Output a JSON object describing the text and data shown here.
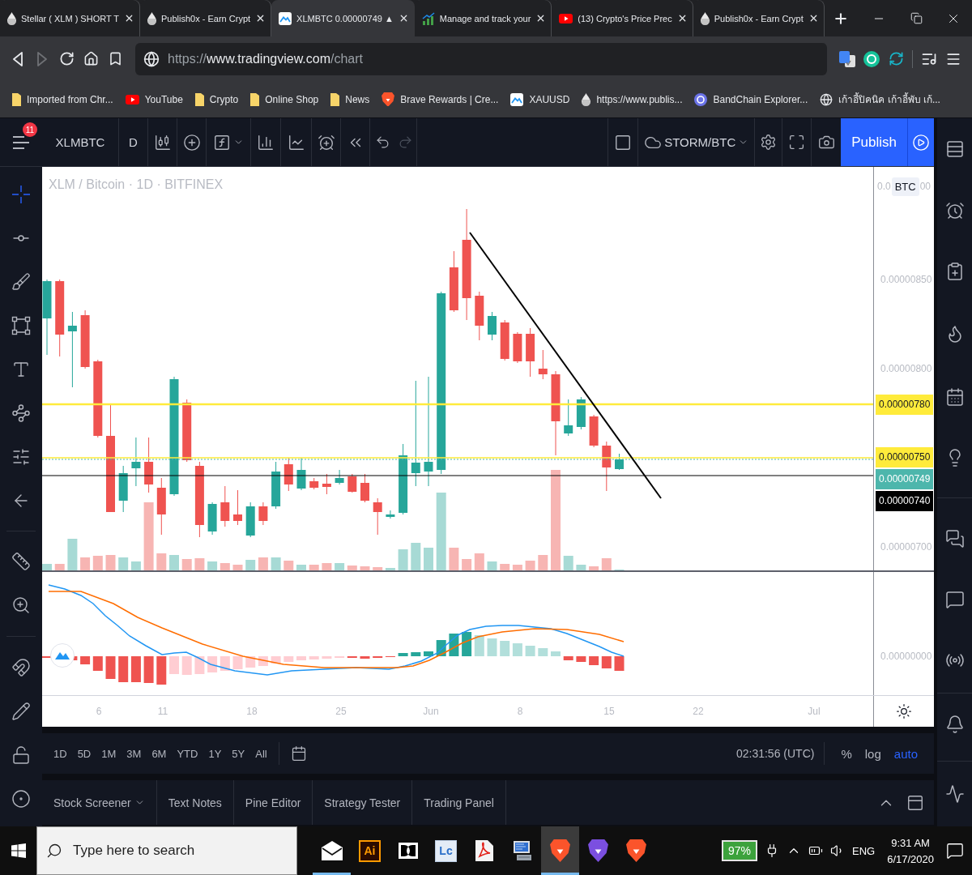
{
  "browser": {
    "tabs": [
      {
        "title": "Stellar ( XLM ) SHORT T",
        "kind": "drop",
        "selected": false
      },
      {
        "title": "Publish0x - Earn Crypt",
        "kind": "drop",
        "selected": false
      },
      {
        "title": "XLMBTC 0.00000749 ▲",
        "kind": "chart",
        "selected": true
      },
      {
        "title": "Manage and track your",
        "kind": "growth",
        "selected": false
      },
      {
        "title": "(13) Crypto's Price Prec",
        "kind": "video",
        "selected": false
      },
      {
        "title": "Publish0x - Earn Crypt",
        "kind": "drop",
        "selected": false
      }
    ],
    "navigation": [
      {
        "disabled": false
      },
      {
        "disabled": true
      }
    ],
    "address": {
      "scheme": "https://",
      "host": "www.tradingview.com",
      "path": "/chart"
    },
    "bookmarks": [
      {
        "label": "Imported from Chr...",
        "kind": "folder"
      },
      {
        "label": "YouTube",
        "kind": "video"
      },
      {
        "label": "Crypto",
        "kind": "folder"
      },
      {
        "label": "Online Shop",
        "kind": "folder"
      },
      {
        "label": "News",
        "kind": "folder"
      },
      {
        "label": "Brave Rewards | Cre...",
        "kind": "shield"
      },
      {
        "label": "XAUUSD",
        "kind": "chart"
      },
      {
        "label": "https://www.publis...",
        "kind": "drop"
      },
      {
        "label": "BandChain Explorer...",
        "kind": "coin"
      },
      {
        "label": "เก้าอี้ปิคนิค เก้าอี้พับ เก้...",
        "kind": "globe"
      }
    ]
  },
  "app": {
    "menu_badge": "11",
    "toolbar": {
      "symbol": "XLMBTC",
      "interval": "D",
      "history": [
        {
          "disabled": false
        },
        {
          "disabled": true
        }
      ],
      "compare": "STORM/BTC",
      "publish": "Publish"
    },
    "drawing_tools": [
      {
        "selected": true
      },
      {
        "selected": false
      },
      {
        "selected": false
      },
      {
        "selected": false
      },
      {
        "selected": false
      },
      {
        "selected": false
      },
      {
        "selected": false
      },
      {
        "selected": false
      },
      {
        "selected": false
      },
      {
        "selected": false
      },
      {
        "selected": false
      },
      {
        "selected": false
      },
      {
        "selected": false
      },
      {
        "selected": false
      }
    ],
    "chart": {
      "legend": "XLM / Bitcoin · 1D · BITFINEX",
      "currency": "BTC",
      "top_tick": {
        "start": "0.0",
        "end": "00"
      },
      "price_ticks": [
        "0.00000850",
        "0.00000800",
        "0.00000700"
      ],
      "price_lines": [
        {
          "label": "0.00000780",
          "color": "#ffeb3b"
        },
        {
          "label": "0.00000750",
          "color": "#ffeb3b"
        },
        {
          "label": "0.00000749",
          "color": "#4db6ac"
        },
        {
          "label": "0.00000740",
          "color": "#000000"
        }
      ],
      "macd_ticks": [
        "0.00000000"
      ],
      "time_ticks": [
        "6",
        "11",
        "18",
        "25",
        "Jun",
        "8",
        "15",
        "22",
        "Jul"
      ]
    },
    "range_bar": {
      "ranges": [
        "1D",
        "5D",
        "1M",
        "3M",
        "6M",
        "YTD",
        "1Y",
        "5Y",
        "All"
      ],
      "clock": "02:31:56 (UTC)",
      "scales": [
        {
          "label": "%",
          "selected": false
        },
        {
          "label": "log",
          "selected": false
        },
        {
          "label": "auto",
          "selected": true
        }
      ]
    },
    "panel_tabs": [
      {
        "label": "Stock Screener",
        "kind": "dropdown",
        "selected": false
      },
      {
        "label": "Text Notes",
        "kind": "tab",
        "selected": false
      },
      {
        "label": "Pine Editor",
        "kind": "tab",
        "selected": false
      },
      {
        "label": "Strategy Tester",
        "kind": "tab",
        "selected": false
      },
      {
        "label": "Trading Panel",
        "kind": "tab",
        "selected": false
      }
    ]
  },
  "taskbar": {
    "search": {
      "placeholder": "Type here to search"
    },
    "apps": [
      {
        "kind": "mail",
        "running": true,
        "selected": false
      },
      {
        "kind": "dark-tile",
        "label": "Ai",
        "color": "#ff9a00",
        "running": false,
        "selected": false
      },
      {
        "kind": "split",
        "running": false,
        "selected": false
      },
      {
        "kind": "light-tile",
        "label": "Lc",
        "color": "#2a6fc9",
        "running": false,
        "selected": false
      },
      {
        "kind": "pdf",
        "running": false,
        "selected": false
      },
      {
        "kind": "monitor",
        "running": false,
        "selected": false
      },
      {
        "kind": "shield",
        "color": "#fb542b",
        "running": true,
        "selected": true
      },
      {
        "kind": "shield",
        "color": "#7b4fe0",
        "running": false,
        "selected": false
      },
      {
        "kind": "shield",
        "color": "#fb542b",
        "running": false,
        "selected": false
      }
    ],
    "battery": "97%",
    "language": "ENG",
    "time": "9:31 AM",
    "date": "6/17/2020"
  }
}
